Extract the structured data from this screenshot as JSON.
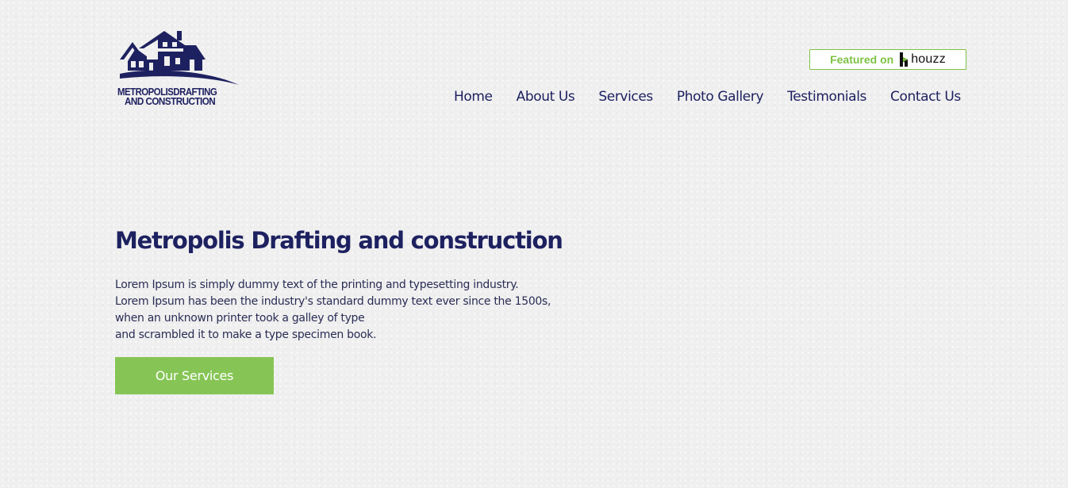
{
  "brand": {
    "logo_line1": "METROPOLISDRAFTING",
    "logo_line2": "AND CONSTRUCTION",
    "icon": "house-logo-icon",
    "color": "#1e2160"
  },
  "badge": {
    "featured_text": "Featured on",
    "service_name": "houzz",
    "icon": "houzz-icon",
    "accent_color": "#7dc243"
  },
  "nav": {
    "items": [
      {
        "label": "Home"
      },
      {
        "label": "About Us"
      },
      {
        "label": "Services"
      },
      {
        "label": "Photo Gallery"
      },
      {
        "label": "Testimonials"
      },
      {
        "label": "Contact Us"
      }
    ]
  },
  "hero": {
    "title": "Metropolis Drafting and construction",
    "body_lines": [
      "Lorem Ipsum is simply dummy text of the printing and typesetting industry.",
      "Lorem Ipsum has been the industry's standard dummy text ever since the 1500s,",
      "when an unknown printer took a galley of type",
      "and scrambled it to make a type specimen book."
    ],
    "button_label": "Our Services",
    "button_color": "#86c555"
  }
}
